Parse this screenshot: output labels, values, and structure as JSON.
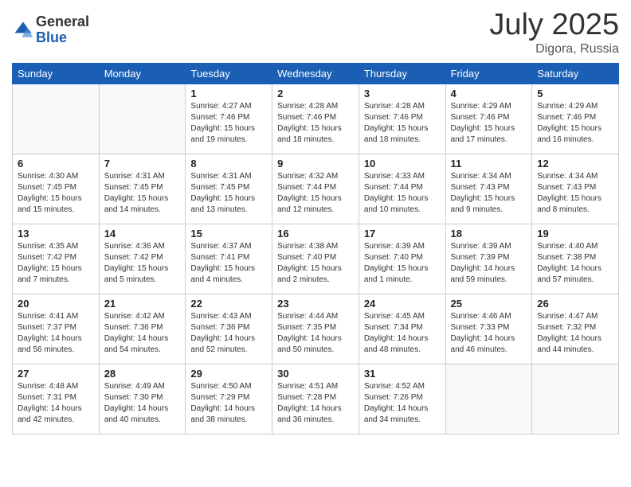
{
  "header": {
    "logo_general": "General",
    "logo_blue": "Blue",
    "month_year": "July 2025",
    "location": "Digora, Russia"
  },
  "weekdays": [
    "Sunday",
    "Monday",
    "Tuesday",
    "Wednesday",
    "Thursday",
    "Friday",
    "Saturday"
  ],
  "weeks": [
    [
      {
        "day": "",
        "sunrise": "",
        "sunset": "",
        "daylight": ""
      },
      {
        "day": "",
        "sunrise": "",
        "sunset": "",
        "daylight": ""
      },
      {
        "day": "1",
        "sunrise": "Sunrise: 4:27 AM",
        "sunset": "Sunset: 7:46 PM",
        "daylight": "Daylight: 15 hours and 19 minutes."
      },
      {
        "day": "2",
        "sunrise": "Sunrise: 4:28 AM",
        "sunset": "Sunset: 7:46 PM",
        "daylight": "Daylight: 15 hours and 18 minutes."
      },
      {
        "day": "3",
        "sunrise": "Sunrise: 4:28 AM",
        "sunset": "Sunset: 7:46 PM",
        "daylight": "Daylight: 15 hours and 18 minutes."
      },
      {
        "day": "4",
        "sunrise": "Sunrise: 4:29 AM",
        "sunset": "Sunset: 7:46 PM",
        "daylight": "Daylight: 15 hours and 17 minutes."
      },
      {
        "day": "5",
        "sunrise": "Sunrise: 4:29 AM",
        "sunset": "Sunset: 7:46 PM",
        "daylight": "Daylight: 15 hours and 16 minutes."
      }
    ],
    [
      {
        "day": "6",
        "sunrise": "Sunrise: 4:30 AM",
        "sunset": "Sunset: 7:45 PM",
        "daylight": "Daylight: 15 hours and 15 minutes."
      },
      {
        "day": "7",
        "sunrise": "Sunrise: 4:31 AM",
        "sunset": "Sunset: 7:45 PM",
        "daylight": "Daylight: 15 hours and 14 minutes."
      },
      {
        "day": "8",
        "sunrise": "Sunrise: 4:31 AM",
        "sunset": "Sunset: 7:45 PM",
        "daylight": "Daylight: 15 hours and 13 minutes."
      },
      {
        "day": "9",
        "sunrise": "Sunrise: 4:32 AM",
        "sunset": "Sunset: 7:44 PM",
        "daylight": "Daylight: 15 hours and 12 minutes."
      },
      {
        "day": "10",
        "sunrise": "Sunrise: 4:33 AM",
        "sunset": "Sunset: 7:44 PM",
        "daylight": "Daylight: 15 hours and 10 minutes."
      },
      {
        "day": "11",
        "sunrise": "Sunrise: 4:34 AM",
        "sunset": "Sunset: 7:43 PM",
        "daylight": "Daylight: 15 hours and 9 minutes."
      },
      {
        "day": "12",
        "sunrise": "Sunrise: 4:34 AM",
        "sunset": "Sunset: 7:43 PM",
        "daylight": "Daylight: 15 hours and 8 minutes."
      }
    ],
    [
      {
        "day": "13",
        "sunrise": "Sunrise: 4:35 AM",
        "sunset": "Sunset: 7:42 PM",
        "daylight": "Daylight: 15 hours and 7 minutes."
      },
      {
        "day": "14",
        "sunrise": "Sunrise: 4:36 AM",
        "sunset": "Sunset: 7:42 PM",
        "daylight": "Daylight: 15 hours and 5 minutes."
      },
      {
        "day": "15",
        "sunrise": "Sunrise: 4:37 AM",
        "sunset": "Sunset: 7:41 PM",
        "daylight": "Daylight: 15 hours and 4 minutes."
      },
      {
        "day": "16",
        "sunrise": "Sunrise: 4:38 AM",
        "sunset": "Sunset: 7:40 PM",
        "daylight": "Daylight: 15 hours and 2 minutes."
      },
      {
        "day": "17",
        "sunrise": "Sunrise: 4:39 AM",
        "sunset": "Sunset: 7:40 PM",
        "daylight": "Daylight: 15 hours and 1 minute."
      },
      {
        "day": "18",
        "sunrise": "Sunrise: 4:39 AM",
        "sunset": "Sunset: 7:39 PM",
        "daylight": "Daylight: 14 hours and 59 minutes."
      },
      {
        "day": "19",
        "sunrise": "Sunrise: 4:40 AM",
        "sunset": "Sunset: 7:38 PM",
        "daylight": "Daylight: 14 hours and 57 minutes."
      }
    ],
    [
      {
        "day": "20",
        "sunrise": "Sunrise: 4:41 AM",
        "sunset": "Sunset: 7:37 PM",
        "daylight": "Daylight: 14 hours and 56 minutes."
      },
      {
        "day": "21",
        "sunrise": "Sunrise: 4:42 AM",
        "sunset": "Sunset: 7:36 PM",
        "daylight": "Daylight: 14 hours and 54 minutes."
      },
      {
        "day": "22",
        "sunrise": "Sunrise: 4:43 AM",
        "sunset": "Sunset: 7:36 PM",
        "daylight": "Daylight: 14 hours and 52 minutes."
      },
      {
        "day": "23",
        "sunrise": "Sunrise: 4:44 AM",
        "sunset": "Sunset: 7:35 PM",
        "daylight": "Daylight: 14 hours and 50 minutes."
      },
      {
        "day": "24",
        "sunrise": "Sunrise: 4:45 AM",
        "sunset": "Sunset: 7:34 PM",
        "daylight": "Daylight: 14 hours and 48 minutes."
      },
      {
        "day": "25",
        "sunrise": "Sunrise: 4:46 AM",
        "sunset": "Sunset: 7:33 PM",
        "daylight": "Daylight: 14 hours and 46 minutes."
      },
      {
        "day": "26",
        "sunrise": "Sunrise: 4:47 AM",
        "sunset": "Sunset: 7:32 PM",
        "daylight": "Daylight: 14 hours and 44 minutes."
      }
    ],
    [
      {
        "day": "27",
        "sunrise": "Sunrise: 4:48 AM",
        "sunset": "Sunset: 7:31 PM",
        "daylight": "Daylight: 14 hours and 42 minutes."
      },
      {
        "day": "28",
        "sunrise": "Sunrise: 4:49 AM",
        "sunset": "Sunset: 7:30 PM",
        "daylight": "Daylight: 14 hours and 40 minutes."
      },
      {
        "day": "29",
        "sunrise": "Sunrise: 4:50 AM",
        "sunset": "Sunset: 7:29 PM",
        "daylight": "Daylight: 14 hours and 38 minutes."
      },
      {
        "day": "30",
        "sunrise": "Sunrise: 4:51 AM",
        "sunset": "Sunset: 7:28 PM",
        "daylight": "Daylight: 14 hours and 36 minutes."
      },
      {
        "day": "31",
        "sunrise": "Sunrise: 4:52 AM",
        "sunset": "Sunset: 7:26 PM",
        "daylight": "Daylight: 14 hours and 34 minutes."
      },
      {
        "day": "",
        "sunrise": "",
        "sunset": "",
        "daylight": ""
      },
      {
        "day": "",
        "sunrise": "",
        "sunset": "",
        "daylight": ""
      }
    ]
  ]
}
